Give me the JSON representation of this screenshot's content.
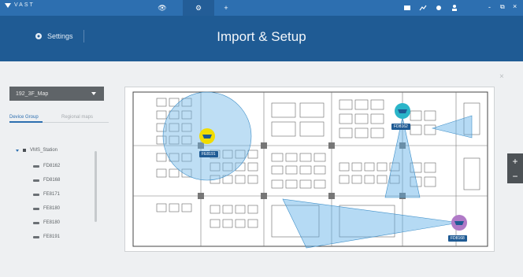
{
  "app": {
    "brand": "VAST"
  },
  "topbar": {
    "tabs": [
      {
        "name": "eye",
        "label": "👁"
      },
      {
        "name": "gear",
        "label": "⚙"
      },
      {
        "name": "add",
        "label": "+"
      }
    ],
    "right_controls": [
      "-",
      "⧉",
      "×"
    ]
  },
  "header": {
    "settings_label": "Settings",
    "title": "Import & Setup"
  },
  "left_panel": {
    "map_select_value": "192_3F_Map",
    "subtabs": [
      {
        "label": "Device Group",
        "active": true
      },
      {
        "label": "Regional maps",
        "active": false
      }
    ],
    "tree": {
      "root": "VMS_Station",
      "items": [
        "FD8162",
        "FD8168",
        "FE8171",
        "FE8180",
        "FE8180",
        "FE8191"
      ]
    }
  },
  "map": {
    "cameras": [
      {
        "label": "FE8191",
        "color": "#f1dc00"
      },
      {
        "label": "FD8162",
        "color": "#2bb5c9"
      },
      {
        "label": "FD8168",
        "color": "#b07ac7"
      }
    ]
  },
  "controls": {
    "close": "×",
    "zoom_in": "+",
    "zoom_out": "−"
  }
}
